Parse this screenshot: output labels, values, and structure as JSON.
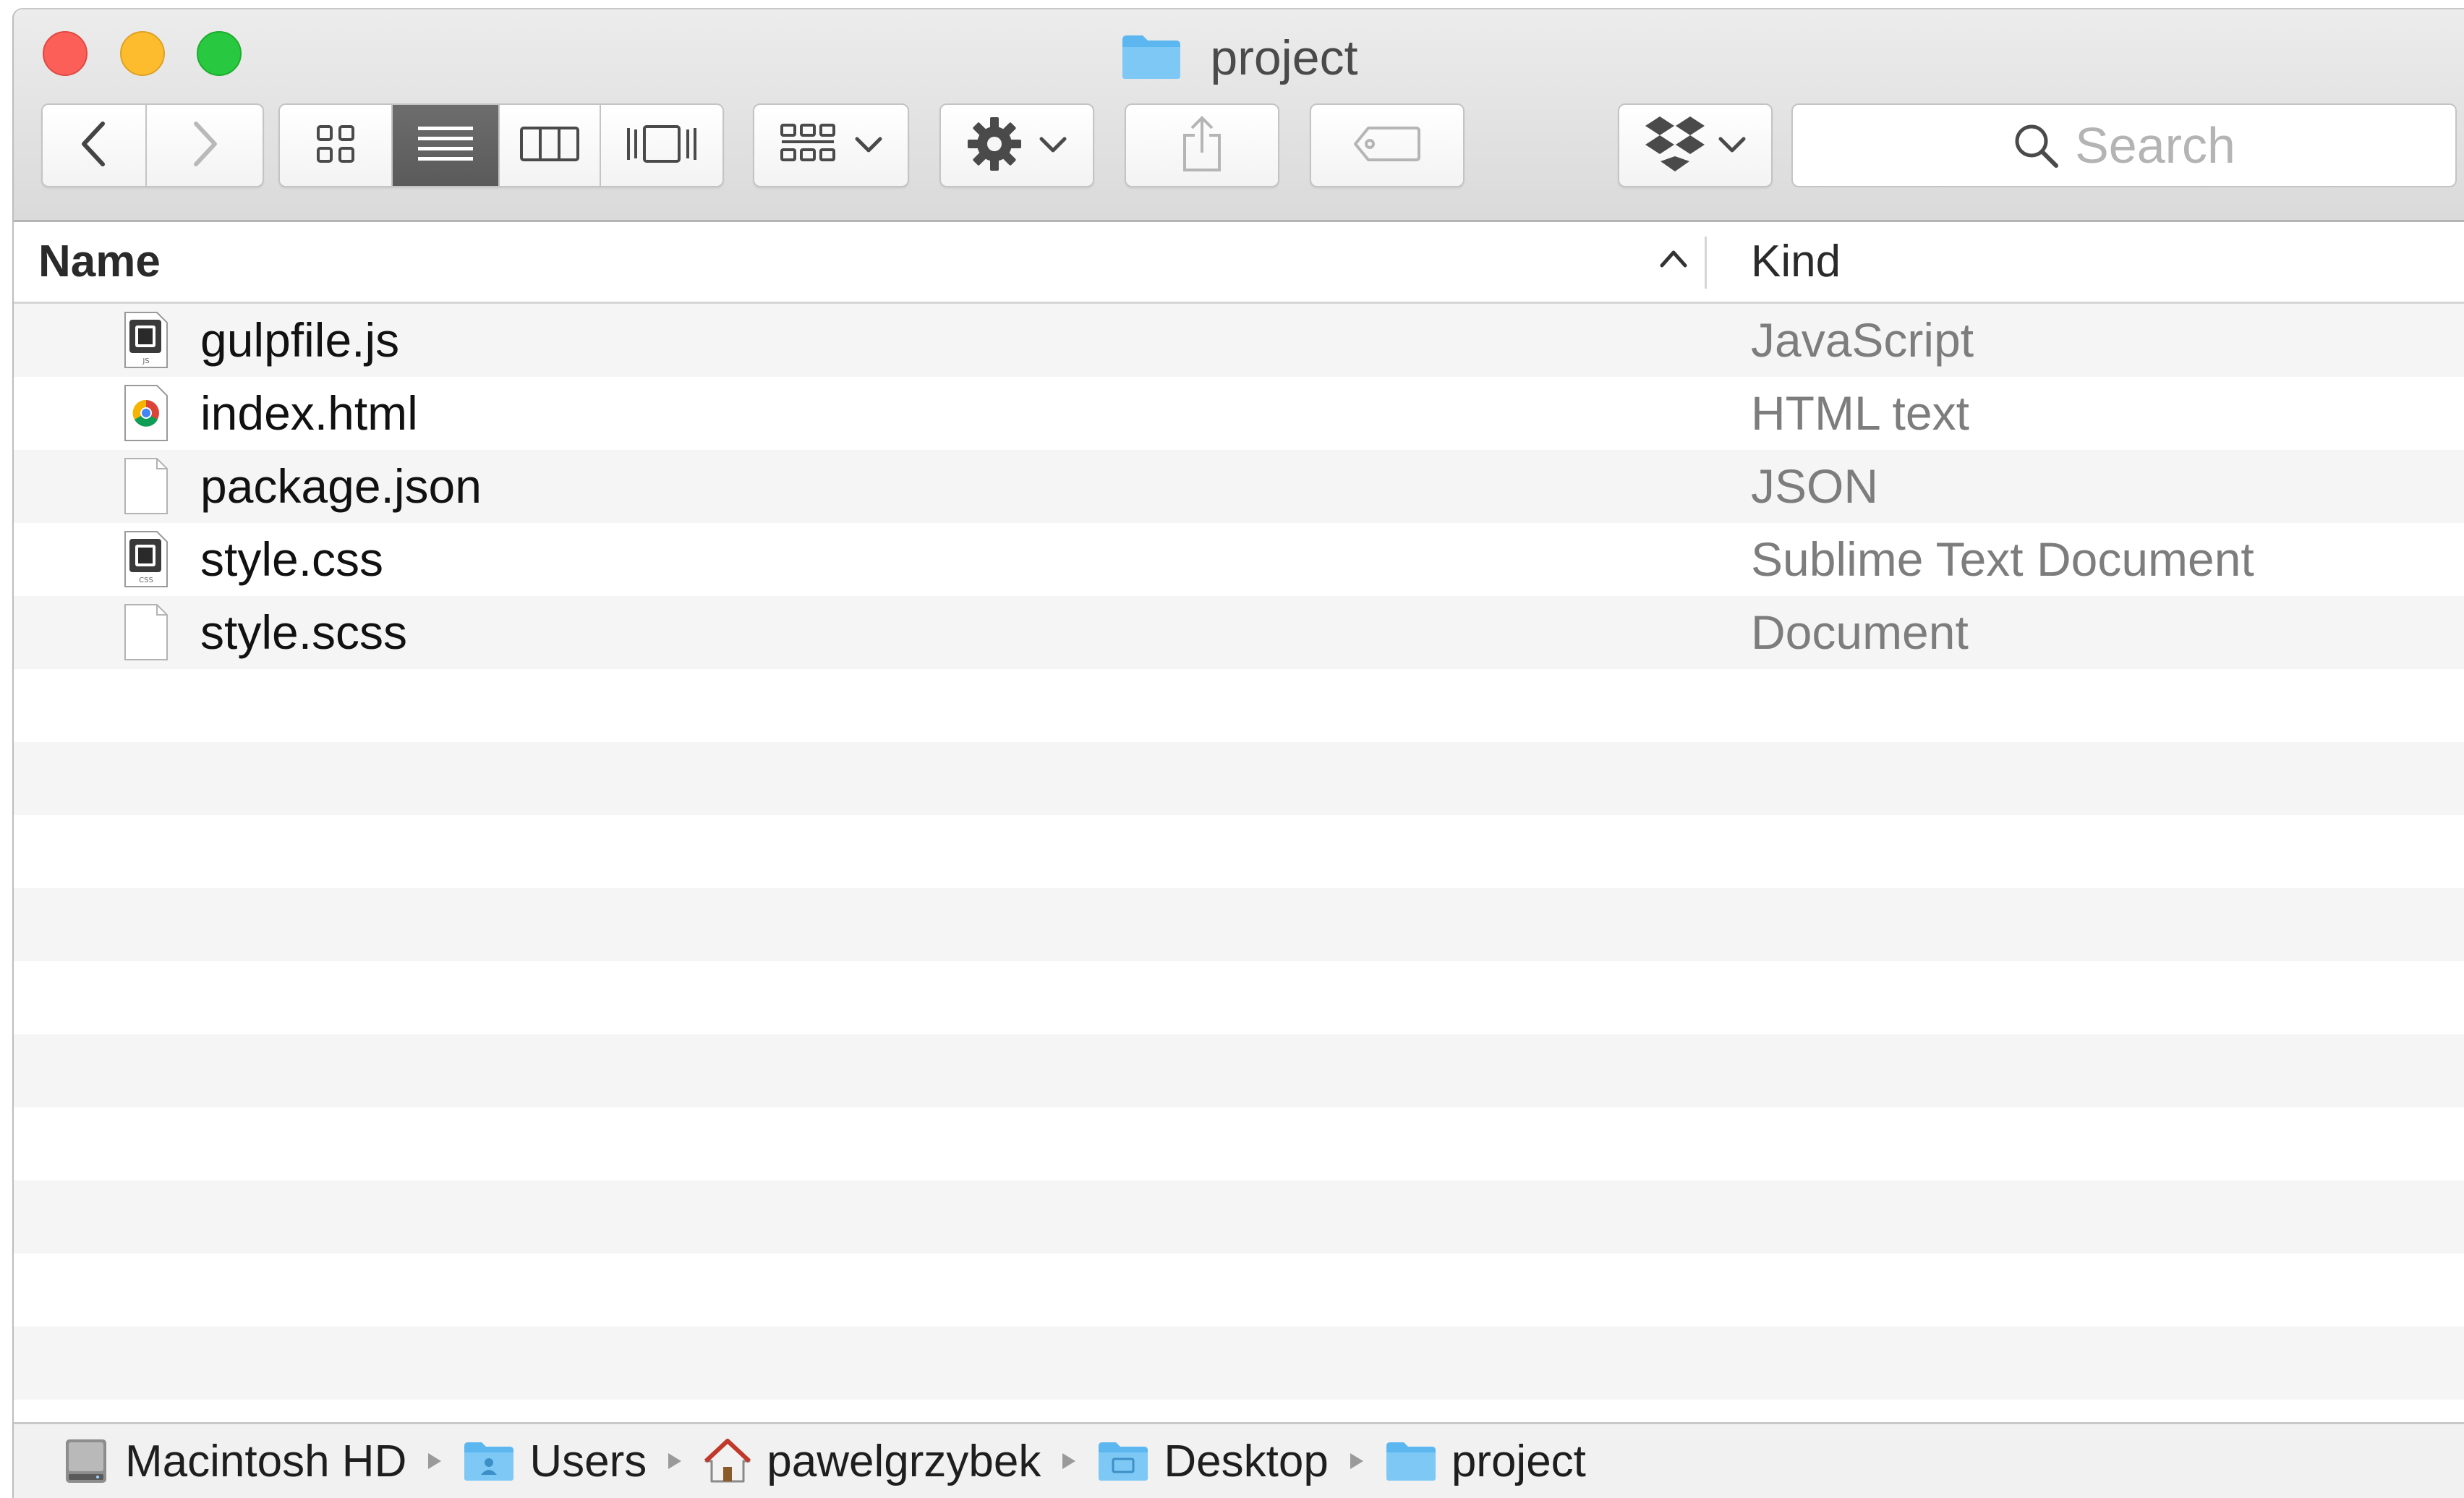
{
  "window": {
    "title": "project"
  },
  "toolbar": {
    "back_icon": "chevron-left-icon",
    "forward_icon": "chevron-right-icon",
    "view_modes": [
      {
        "name": "icon-view",
        "icon": "grid-icon",
        "selected": false
      },
      {
        "name": "list-view",
        "icon": "list-icon",
        "selected": true
      },
      {
        "name": "column-view",
        "icon": "columns-icon",
        "selected": false
      },
      {
        "name": "cover-flow-view",
        "icon": "cover-flow-icon",
        "selected": false
      }
    ],
    "arrange_icon": "arrange-grid-icon",
    "action_icon": "gear-icon",
    "share_icon": "share-icon",
    "tags_icon": "tag-icon",
    "dropbox_icon": "dropbox-icon"
  },
  "search": {
    "placeholder": "Search"
  },
  "columns": {
    "name": "Name",
    "kind": "Kind"
  },
  "files": [
    {
      "name": "gulpfile.js",
      "kind": "JavaScript",
      "icon": "sublime-js-icon"
    },
    {
      "name": "index.html",
      "kind": "HTML text",
      "icon": "chrome-document-icon"
    },
    {
      "name": "package.json",
      "kind": "JSON",
      "icon": "blank-document-icon"
    },
    {
      "name": "style.css",
      "kind": "Sublime Text Document",
      "icon": "sublime-css-icon"
    },
    {
      "name": "style.scss",
      "kind": "Document",
      "icon": "blank-document-icon"
    }
  ],
  "path": [
    {
      "label": "Macintosh HD",
      "icon": "hard-drive-icon"
    },
    {
      "label": "Users",
      "icon": "users-folder-icon"
    },
    {
      "label": "pawelgrzybek",
      "icon": "home-icon"
    },
    {
      "label": "Desktop",
      "icon": "desktop-folder-icon"
    },
    {
      "label": "project",
      "icon": "folder-icon"
    }
  ],
  "colors": {
    "folder_blue": "#5cb7f0",
    "close": "#fc5f57",
    "minimize": "#fdbc2e",
    "zoom": "#28c840",
    "selected_segment": "#5f5f5f"
  }
}
